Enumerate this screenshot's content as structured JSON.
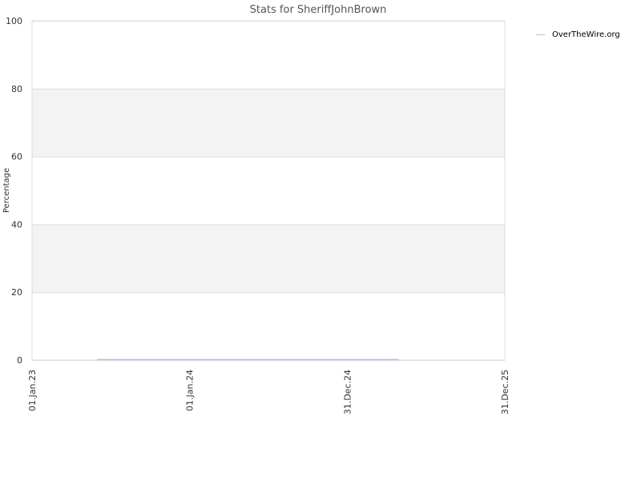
{
  "chart_data": {
    "type": "line",
    "title": "Stats for SheriffJohnBrown",
    "ylabel": "Percentage",
    "xlabel": "",
    "ylim": [
      0,
      100
    ],
    "y_ticks": [
      "0",
      "20",
      "40",
      "60",
      "80",
      "100"
    ],
    "x_range": [
      "2023-01-01",
      "2025-12-31"
    ],
    "x_ticks": [
      {
        "label": "01.Jan.23",
        "date": "2023-01-01"
      },
      {
        "label": "01.Jan.24",
        "date": "2024-01-01"
      },
      {
        "label": "31.Dec.24",
        "date": "2024-12-31"
      },
      {
        "label": "31.Dec.25",
        "date": "2025-12-31"
      }
    ],
    "alternating_bands": true,
    "band_color": "#f3f3f3",
    "grid_color": "#dddddd",
    "legend_position": "top-right",
    "series": [
      {
        "name": "OverTheWire.org",
        "color": "#a8c4e0",
        "points": [
          {
            "x": "2023-06-01",
            "y": 0
          },
          {
            "x": "2024-12-31",
            "y": 0
          },
          {
            "x": "2025-04-29",
            "y": 0
          }
        ]
      }
    ]
  }
}
